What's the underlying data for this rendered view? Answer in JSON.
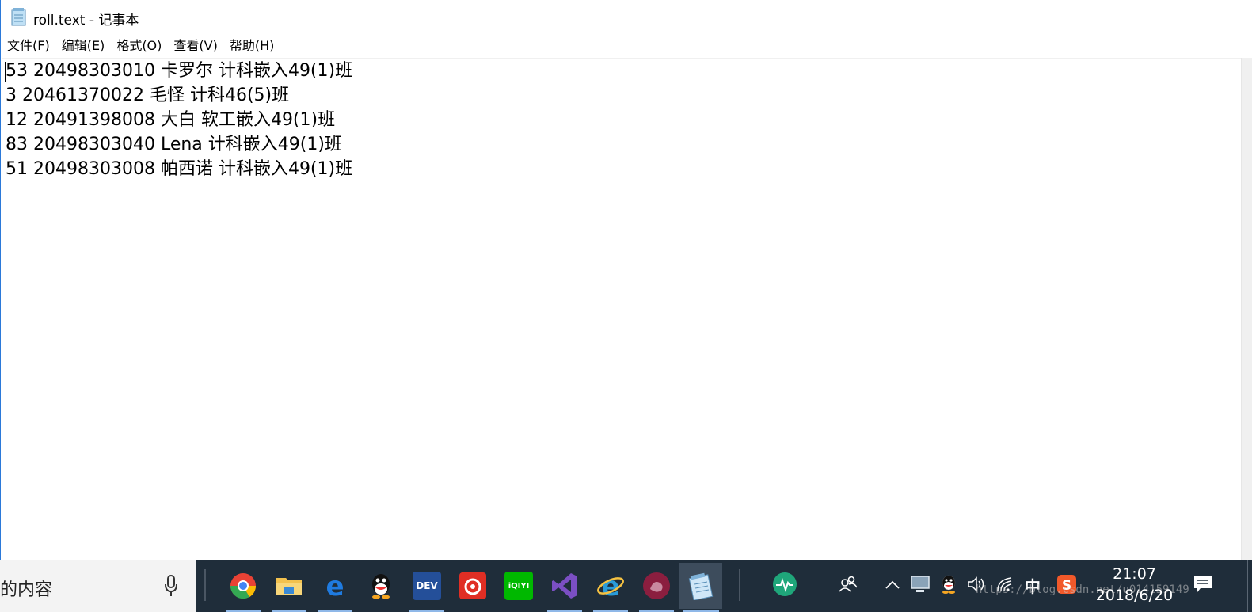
{
  "window": {
    "title": "roll.text - 记事本",
    "menu": [
      "文件(F)",
      "编辑(E)",
      "格式(O)",
      "查看(V)",
      "帮助(H)"
    ],
    "lines": [
      "53 20498303010 卡罗尔 计科嵌入49(1)班",
      "3 20461370022 毛怪 计科46(5)班",
      "12 20491398008 大白 软工嵌入49(1)班",
      "83 20498303040 Lena 计科嵌入49(1)班",
      "51 20498303008 帕西诺 计科嵌入49(1)班"
    ]
  },
  "taskbar": {
    "search_text": "的内容",
    "apps": [
      {
        "name": "chrome-icon",
        "color": "#e94235",
        "label": ""
      },
      {
        "name": "file-explorer-icon",
        "color": "#f2c14e",
        "label": ""
      },
      {
        "name": "edge-icon",
        "color": "#1f6fd1",
        "label": "e"
      },
      {
        "name": "qq-icon",
        "color": "#1f2d3a",
        "label": ""
      },
      {
        "name": "devcpp-icon",
        "color": "#2a5aa8",
        "label": "DEV"
      },
      {
        "name": "netease-music-icon",
        "color": "#e02e24",
        "label": ""
      },
      {
        "name": "iqiyi-icon",
        "color": "#00c000",
        "label": "iQIYI"
      },
      {
        "name": "visual-studio-icon",
        "color": "#7b4fc3",
        "label": ""
      },
      {
        "name": "ie-icon",
        "color": "#2a9bd8",
        "label": "e"
      },
      {
        "name": "app-icon",
        "color": "#8b1e3f",
        "label": ""
      },
      {
        "name": "notepad-icon",
        "color": "#9cc4e6",
        "label": ""
      }
    ],
    "ime": "中",
    "time": "21:07",
    "date": "2018/6/20",
    "watermark": "https://blog.csdn.net/u014159149"
  }
}
